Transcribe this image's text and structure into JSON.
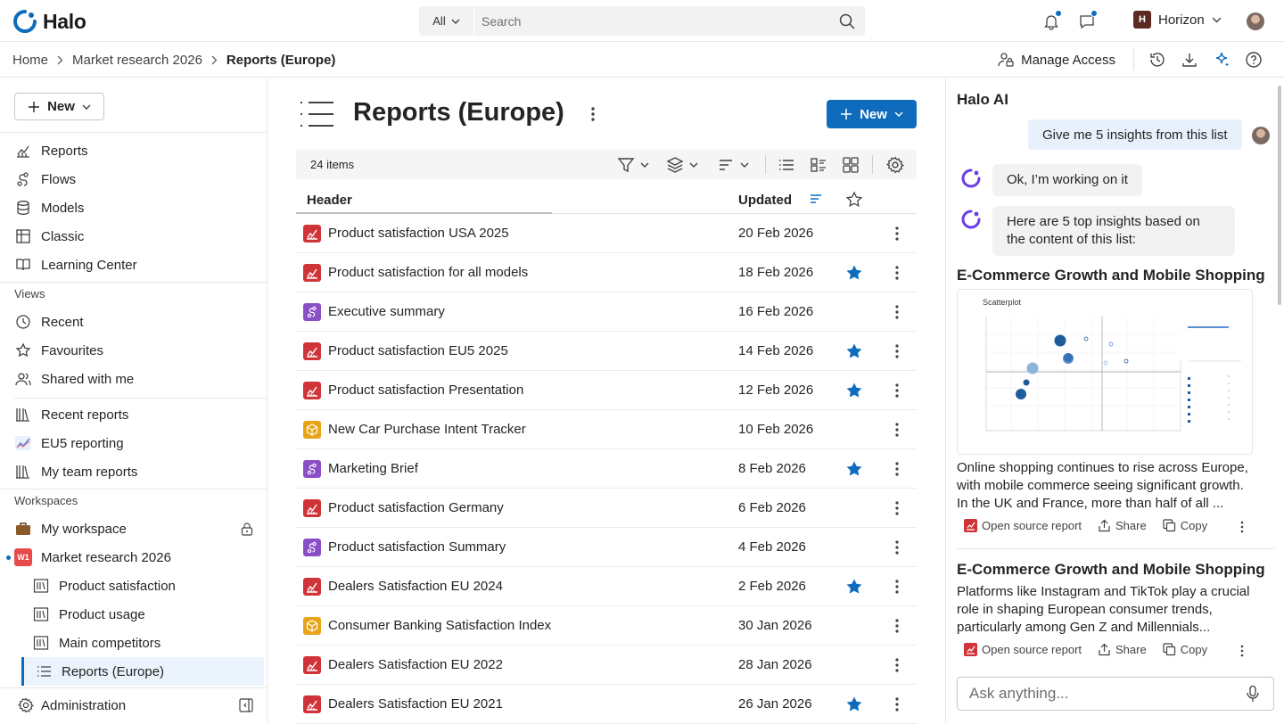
{
  "app": {
    "name": "Halo"
  },
  "search": {
    "scope": "All",
    "placeholder": "Search"
  },
  "org": {
    "badge": "H",
    "name": "Horizon"
  },
  "breadcrumb": {
    "items": [
      "Home",
      "Market research 2026"
    ],
    "current": "Reports (Europe)"
  },
  "crumb_actions": {
    "manage_access": "Manage Access"
  },
  "left_nav": {
    "new_label": "New",
    "primary": [
      {
        "label": "Reports",
        "icon": "chart-icon"
      },
      {
        "label": "Flows",
        "icon": "flow-icon"
      },
      {
        "label": "Models",
        "icon": "database-icon"
      },
      {
        "label": "Classic",
        "icon": "table-icon"
      },
      {
        "label": "Learning Center",
        "icon": "book-icon"
      }
    ],
    "views_title": "Views",
    "views": [
      {
        "label": "Recent",
        "icon": "clock-icon"
      },
      {
        "label": "Favourites",
        "icon": "star-icon"
      },
      {
        "label": "Shared with me",
        "icon": "people-icon"
      }
    ],
    "reports_views": [
      {
        "label": "Recent reports",
        "icon": "library-icon"
      },
      {
        "label": "EU5 reporting",
        "icon": "trend-icon"
      },
      {
        "label": "My team reports",
        "icon": "library-icon"
      }
    ],
    "workspaces_title": "Workspaces",
    "workspaces": [
      {
        "label": "My workspace",
        "icon": "briefcase-icon"
      },
      {
        "label": "Market research 2026",
        "badge": "W1"
      }
    ],
    "sub_items": [
      {
        "label": "Product satisfaction"
      },
      {
        "label": "Product usage"
      },
      {
        "label": "Main competitors"
      },
      {
        "label": "Reports (Europe)"
      }
    ],
    "admin_label": "Administration"
  },
  "main": {
    "title": "Reports (Europe)",
    "new_label": "New",
    "item_count": "24 items",
    "columns": {
      "header": "Header",
      "updated": "Updated"
    },
    "rows": [
      {
        "name": "Product satisfaction USA 2025",
        "date": "20 Feb 2026",
        "type": "report",
        "starred": false
      },
      {
        "name": "Product satisfaction for all models",
        "date": "18 Feb 2026",
        "type": "report",
        "starred": true
      },
      {
        "name": "Executive summary",
        "date": "16 Feb 2026",
        "type": "flow",
        "starred": false
      },
      {
        "name": "Product satisfaction EU5 2025",
        "date": "14 Feb 2026",
        "type": "report",
        "starred": true
      },
      {
        "name": "Product satisfaction Presentation",
        "date": "12 Feb 2026",
        "type": "report",
        "starred": true
      },
      {
        "name": "New Car Purchase Intent Tracker",
        "date": "10 Feb 2026",
        "type": "model",
        "starred": false
      },
      {
        "name": "Marketing Brief",
        "date": "8 Feb 2026",
        "type": "flow",
        "starred": true
      },
      {
        "name": "Product satisfaction Germany",
        "date": "6 Feb 2026",
        "type": "report",
        "starred": false
      },
      {
        "name": "Product satisfaction Summary",
        "date": "4 Feb 2026",
        "type": "flow",
        "starred": false
      },
      {
        "name": "Dealers Satisfaction EU 2024",
        "date": "2 Feb 2026",
        "type": "report",
        "starred": true
      },
      {
        "name": "Consumer Banking Satisfaction Index",
        "date": "30 Jan 2026",
        "type": "model",
        "starred": false
      },
      {
        "name": "Dealers Satisfaction EU 2022",
        "date": "28 Jan 2026",
        "type": "report",
        "starred": false
      },
      {
        "name": "Dealers Satisfaction EU 2021",
        "date": "26 Jan 2026",
        "type": "report",
        "starred": true
      }
    ]
  },
  "ai_panel": {
    "title": "Halo AI",
    "user_message": "Give me 5 insights from this list",
    "ai_reply_1": "Ok, I’m working on it",
    "ai_reply_2": "Here are 5 top insights based on the content of this list:",
    "insights": [
      {
        "title": "E-Commerce Growth and Mobile Shopping",
        "chart_caption": "Scatterplot",
        "text": "Online shopping continues to rise across Europe, with mobile commerce seeing significant growth. In the UK and France, more than half of all ..."
      },
      {
        "title": "E-Commerce Growth and Mobile Shopping",
        "text": "Platforms like Instagram and TikTok play a crucial role in shaping European consumer trends, particularly among Gen Z and Millennials..."
      }
    ],
    "actions": {
      "open": "Open source report",
      "share": "Share",
      "copy": "Copy"
    },
    "ask_placeholder": "Ask anything..."
  },
  "colors": {
    "accent": "#0f6cbd",
    "report": "#d13438",
    "flow": "#8a4fc7",
    "model": "#e8a317",
    "ai_brand": "#6a3de8"
  }
}
